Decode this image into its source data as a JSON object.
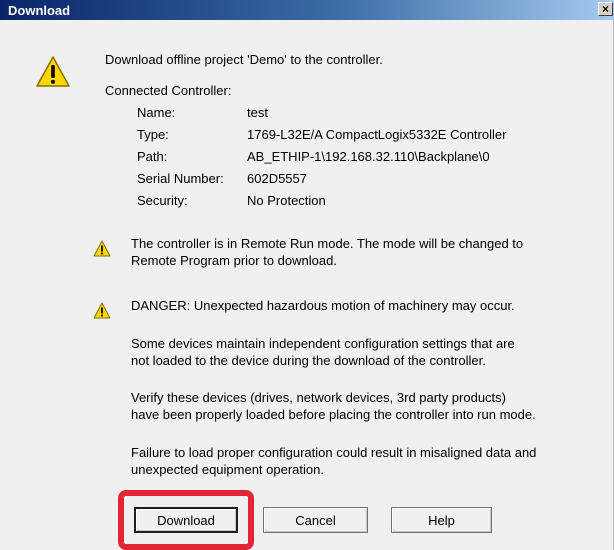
{
  "window": {
    "title": "Download",
    "close_glyph": "×"
  },
  "message": "Download offline project 'Demo' to the controller.",
  "controller": {
    "heading": "Connected Controller:",
    "fields": [
      {
        "label": "Name:",
        "value": "test"
      },
      {
        "label": "Type:",
        "value": "1769-L32E/A CompactLogix5332E Controller"
      },
      {
        "label": "Path:",
        "value": "AB_ETHIP-1\\192.168.32.110\\Backplane\\0"
      },
      {
        "label": "Serial Number:",
        "value": "602D5557"
      },
      {
        "label": "Security:",
        "value": "No Protection"
      }
    ]
  },
  "warnings": {
    "mode_line1": "The controller is in Remote Run mode. The mode will be changed to",
    "mode_line2": "Remote Program prior to download.",
    "danger": "DANGER: Unexpected hazardous motion of machinery may occur.",
    "para1_line1": "Some devices maintain independent configuration settings that are",
    "para1_line2": "not loaded to the device during the download of the controller.",
    "para2_line1": "Verify these devices (drives, network devices, 3rd party products)",
    "para2_line2": "have been properly loaded before placing the controller into run mode.",
    "para3_line1": "Failure to load proper configuration could result in misaligned data and",
    "para3_line2": "unexpected equipment operation."
  },
  "buttons": {
    "download": "Download",
    "cancel": "Cancel",
    "help": "Help"
  },
  "icons": {
    "warning": "warning-triangle-icon",
    "close": "close-icon"
  },
  "colors": {
    "highlight": "#e32636",
    "titlebar": "#0a246a",
    "warning_fill": "#ffd700"
  }
}
